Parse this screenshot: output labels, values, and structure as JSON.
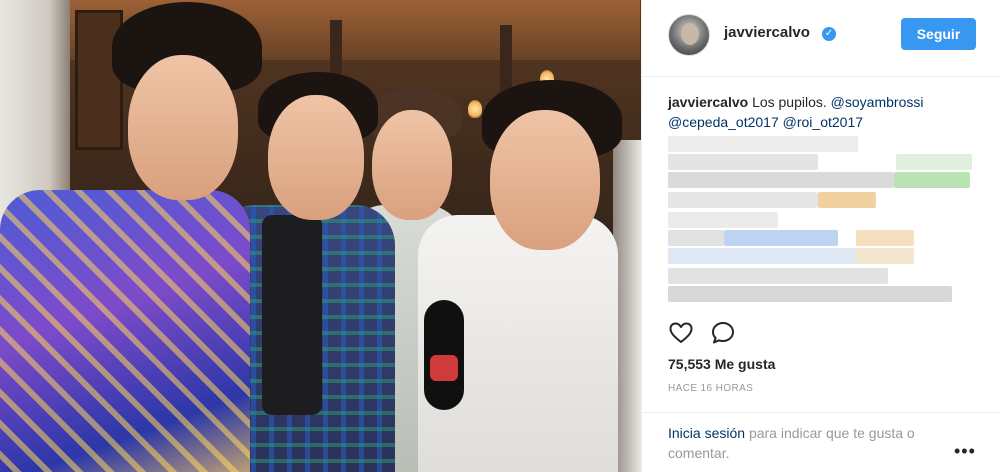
{
  "post": {
    "username": "javviercalvo",
    "follow_label": "Seguir",
    "verified_icon": "verified-badge-icon",
    "caption_user": "javviercalvo",
    "caption_text": "Los pupilos.",
    "mention_1": "@soyambrossi",
    "mention_2": "@cepeda_ot2017",
    "mention_3": "@roi_ot2017",
    "likes": "75,553 Me gusta",
    "time": "HACE 16 HORAS",
    "login_link": "Inicia sesión",
    "login_rest": "para indicar que te gusta o comentar.",
    "more_label": "•••"
  },
  "actions": {
    "like_icon": "heart-icon",
    "comment_icon": "comment-bubble-icon"
  },
  "colors": {
    "accent": "#3897f0",
    "link": "#003569",
    "muted": "#999999",
    "text": "#262626"
  }
}
